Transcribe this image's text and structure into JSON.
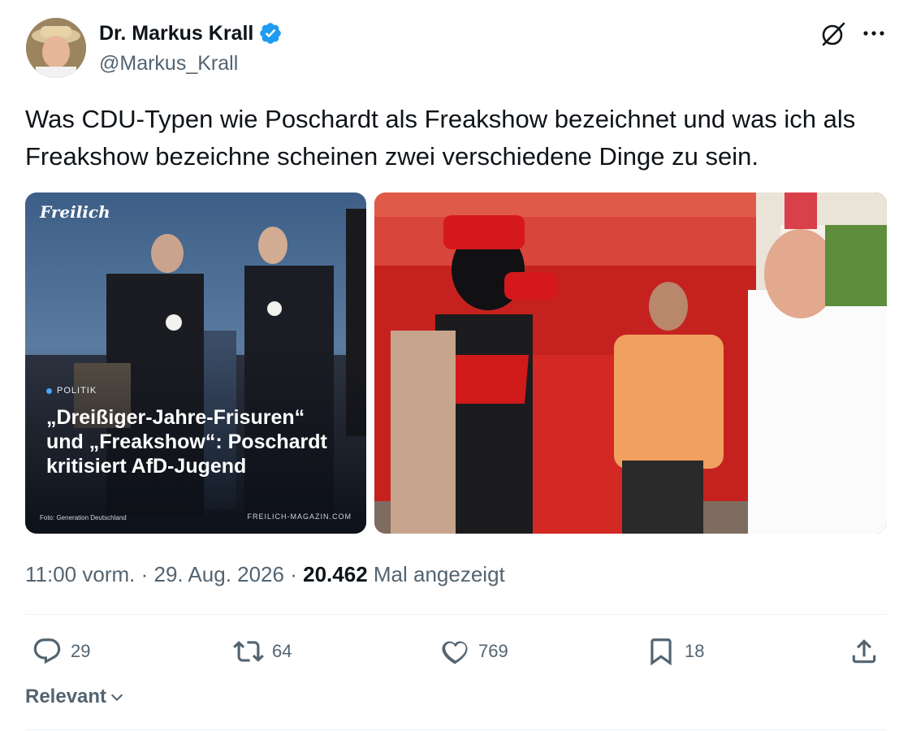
{
  "author": {
    "display_name": "Dr. Markus Krall",
    "handle": "@Markus_Krall"
  },
  "tweet": {
    "text": "Was CDU-Typen wie Poschardt als Freakshow bezeichnet und was ich als Freakshow bezeichne scheinen zwei verschiedene Dinge zu sein."
  },
  "media": {
    "left": {
      "logo": "Freilich",
      "category": "POLITIK",
      "headline": "„Dreißiger-Jahre-Frisuren“ und „Freakshow“: Poschardt kritisiert AfD-Jugend",
      "photo_credit": "Foto: Generation Deutschland",
      "site": "FREILICH-MAGAZIN.COM"
    }
  },
  "meta": {
    "time": "11:00 vorm.",
    "separator1": "·",
    "date": "29. Aug. 2026",
    "separator2": "·",
    "views_count": "20.462",
    "views_label": "Mal angezeigt"
  },
  "actions": {
    "replies": "29",
    "retweets": "64",
    "likes": "769",
    "bookmarks": "18"
  },
  "sort": {
    "label": "Relevant"
  },
  "icons": {
    "verified": "verified-badge-icon",
    "grok": "grok-icon",
    "more": "more-icon",
    "reply": "reply-icon",
    "retweet": "retweet-icon",
    "like": "heart-icon",
    "bookmark": "bookmark-icon",
    "share": "share-icon",
    "chevron": "chevron-down-icon"
  },
  "colors": {
    "verified_blue": "#1d9bf0",
    "secondary_text": "#536471",
    "primary_text": "#0f1419"
  }
}
